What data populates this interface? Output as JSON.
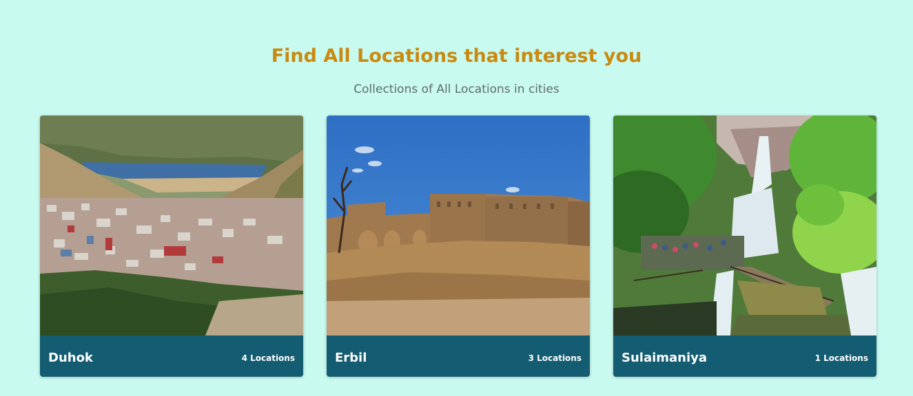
{
  "header": {
    "title": "Find All Locations that interest you",
    "subtitle": "Collections of All Locations in cities"
  },
  "colors": {
    "background": "#c8faf0",
    "title": "#c98a11",
    "subtitle": "#5f6b6c",
    "card_footer": "#135c71"
  },
  "cities": [
    {
      "name": "Duhok",
      "count_label": "4 Locations",
      "image_subject": "city-valley-lake-photo"
    },
    {
      "name": "Erbil",
      "count_label": "3 Locations",
      "image_subject": "citadel-photo"
    },
    {
      "name": "Sulaimaniya",
      "count_label": "1 Locations",
      "image_subject": "waterfall-photo"
    }
  ]
}
